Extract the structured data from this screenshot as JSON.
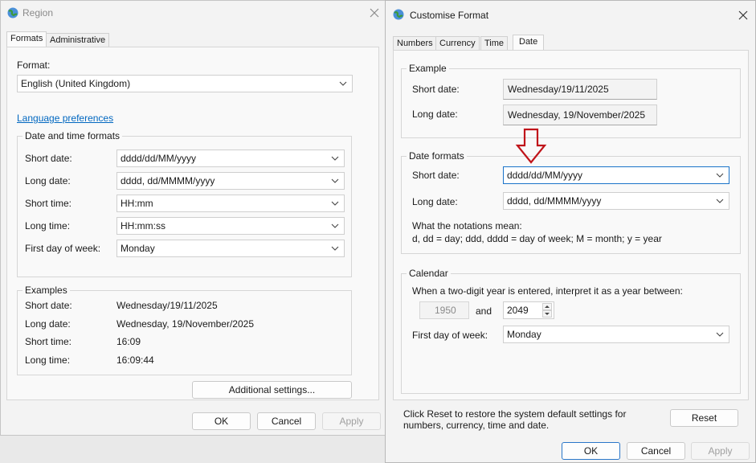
{
  "region": {
    "title": "Region",
    "tabs": [
      "Formats",
      "Administrative"
    ],
    "format_label": "Format:",
    "format_value": "English (United Kingdom)",
    "language_link": "Language preferences",
    "dt_group": "Date and time formats",
    "rows": [
      {
        "label": "Short date:",
        "value": "dddd/dd/MM/yyyy"
      },
      {
        "label": "Long date:",
        "value": "dddd, dd/MMMM/yyyy"
      },
      {
        "label": "Short time:",
        "value": "HH:mm"
      },
      {
        "label": "Long time:",
        "value": "HH:mm:ss"
      },
      {
        "label": "First day of week:",
        "value": "Monday"
      }
    ],
    "examples_group": "Examples",
    "examples": [
      {
        "label": "Short date:",
        "value": "Wednesday/19/11/2025"
      },
      {
        "label": "Long date:",
        "value": "Wednesday, 19/November/2025"
      },
      {
        "label": "Short time:",
        "value": "16:09"
      },
      {
        "label": "Long time:",
        "value": "16:09:44"
      }
    ],
    "additional_settings": "Additional settings...",
    "ok": "OK",
    "cancel": "Cancel",
    "apply": "Apply"
  },
  "custom": {
    "title": "Customise Format",
    "tabs": [
      "Numbers",
      "Currency",
      "Time",
      "Date"
    ],
    "example_group": "Example",
    "example_short_label": "Short date:",
    "example_short_value": "Wednesday/19/11/2025",
    "example_long_label": "Long date:",
    "example_long_value": "Wednesday, 19/November/2025",
    "date_formats_group": "Date formats",
    "short_label": "Short date:",
    "short_value": "dddd/dd/MM/yyyy",
    "long_label": "Long date:",
    "long_value": "dddd, dd/MMMM/yyyy",
    "notation_title": "What the notations mean:",
    "notation_text": "d, dd = day;  ddd, dddd = day of week;  M = month;  y = year",
    "calendar_group": "Calendar",
    "two_digit_text": "When a two-digit year is entered, interpret it as a year between:",
    "year_start": "1950",
    "and": "and",
    "year_end": "2049",
    "first_day_label": "First day of week:",
    "first_day_value": "Monday",
    "reset_note": "Click Reset to restore the system default settings for numbers, currency, time and date.",
    "reset": "Reset",
    "ok": "OK",
    "cancel": "Cancel",
    "apply": "Apply"
  },
  "colors": {
    "accent": "#0067c0",
    "arrow": "#c0141a",
    "focus_border": "#1a73c9"
  },
  "icons": [
    "globe-icon",
    "close-icon",
    "chevron-down-icon",
    "spin-up-icon",
    "spin-down-icon",
    "down-arrow-annotation-icon"
  ]
}
